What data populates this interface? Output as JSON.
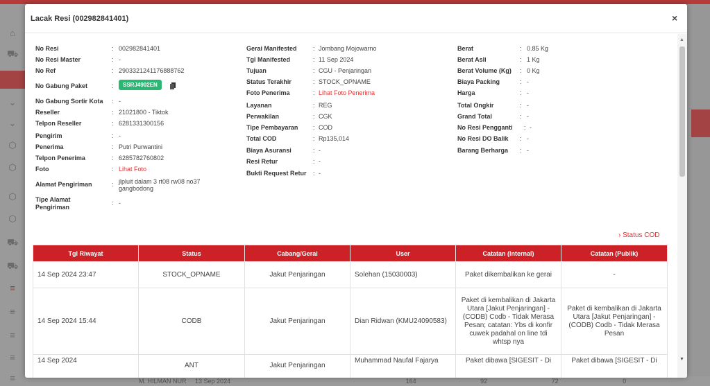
{
  "colors": {
    "accent": "#cc2127",
    "badge": "#2bb673",
    "link": "#dd3333"
  },
  "modal": {
    "title": "Lacak Resi (002982841401)",
    "close": "×"
  },
  "details": {
    "left": [
      {
        "label": "No Resi",
        "value": "002982841401"
      },
      {
        "label": "No Resi Master",
        "value": "-"
      },
      {
        "label": "No Ref",
        "value": "2903321241176888762"
      },
      {
        "label": "No Gabung Paket",
        "value": "SSRJ4902EN"
      },
      {
        "label": "No Gabung Sortir Kota",
        "value": "-"
      },
      {
        "label": "Reseller",
        "value": "21021800 - Tiktok"
      },
      {
        "label": "Telpon Reseller",
        "value": "6281331300156"
      },
      {
        "label": "Pengirim",
        "value": "-"
      },
      {
        "label": "Penerima",
        "value": "Putri Purwantini"
      },
      {
        "label": "Telpon Penerima",
        "value": "6285782760802"
      },
      {
        "label": "Foto",
        "value": "Lihat Foto"
      },
      {
        "label": "Alamat Pengiriman",
        "value": "jlpluit dalam 3 rt08 rw08 no37 gangbodong"
      },
      {
        "label": "Tipe Alamat Pengiriman",
        "value": "-"
      }
    ],
    "middle": [
      {
        "label": "Gerai Manifested",
        "value": "Jombang Mojowarno"
      },
      {
        "label": "Tgl Manifested",
        "value": "11 Sep 2024"
      },
      {
        "label": "Tujuan",
        "value": "CGU - Penjaringan"
      },
      {
        "label": "Status Terakhir",
        "value": "STOCK_OPNAME"
      },
      {
        "label": "Foto Penerima",
        "value": "Lihat Foto Penerima"
      },
      {
        "label": "Layanan",
        "value": "REG"
      },
      {
        "label": "Perwakilan",
        "value": "CGK"
      },
      {
        "label": "Tipe Pembayaran",
        "value": "COD"
      },
      {
        "label": "Total COD",
        "value": "Rp135,014"
      },
      {
        "label": "Biaya Asuransi",
        "value": "-"
      },
      {
        "label": "Resi Retur",
        "value": "-"
      },
      {
        "label": "Bukti Request Retur",
        "value": "-"
      }
    ],
    "right": [
      {
        "label": "Berat",
        "value": "0.85 Kg"
      },
      {
        "label": "Berat Asli",
        "value": "1 Kg"
      },
      {
        "label": "Berat Volume (Kg)",
        "value": "0 Kg"
      },
      {
        "label": "Biaya Packing",
        "value": "-"
      },
      {
        "label": "Harga",
        "value": "-"
      },
      {
        "label": "Total Ongkir",
        "value": "-"
      },
      {
        "label": "Grand Total",
        "value": "-"
      },
      {
        "label": "No Resi Pengganti",
        "value": "-"
      },
      {
        "label": "No Resi DO Balik",
        "value": "-"
      },
      {
        "label": "Barang Berharga",
        "value": "-"
      }
    ]
  },
  "status_cod_link": "› Status COD",
  "history": {
    "headers": [
      "Tgl Riwayat",
      "Status",
      "Cabang/Gerai",
      "User",
      "Catatan (Internal)",
      "Catatan (Publik)"
    ],
    "rows": [
      {
        "tgl": "14 Sep 2024 23:47",
        "status": "STOCK_OPNAME",
        "cabang": "Jakut Penjaringan",
        "user": "Solehan (15030003)",
        "internal": "Paket dikembalikan ke gerai",
        "publik": "-"
      },
      {
        "tgl": "14 Sep 2024 15:44",
        "status": "CODB",
        "cabang": "Jakut Penjaringan",
        "user": "Dian Ridwan (KMU24090583)",
        "internal": "Paket di kembalikan di Jakarta Utara [Jakut Penjaringan] - (CODB) Codb - Tidak Merasa Pesan; catatan: Ybs di konfir cuwek padahal on line tdi whtsp nya",
        "publik": "Paket di kembalikan di Jakarta Utara [Jakut Penjaringan] - (CODB) Codb - Tidak Merasa Pesan"
      },
      {
        "tgl": "14 Sep 2024",
        "status": "ANT",
        "cabang": "Jakut Penjaringan",
        "user": "Muhammad Naufal Fajarya",
        "internal": "Paket dibawa [SIGESIT - Di",
        "publik": "Paket dibawa [SIGESIT - Di"
      }
    ]
  },
  "background": {
    "bottom_row": [
      "M. HILMAN NUR",
      "13 Sep 2024",
      "164",
      "92",
      "72",
      "0"
    ]
  }
}
